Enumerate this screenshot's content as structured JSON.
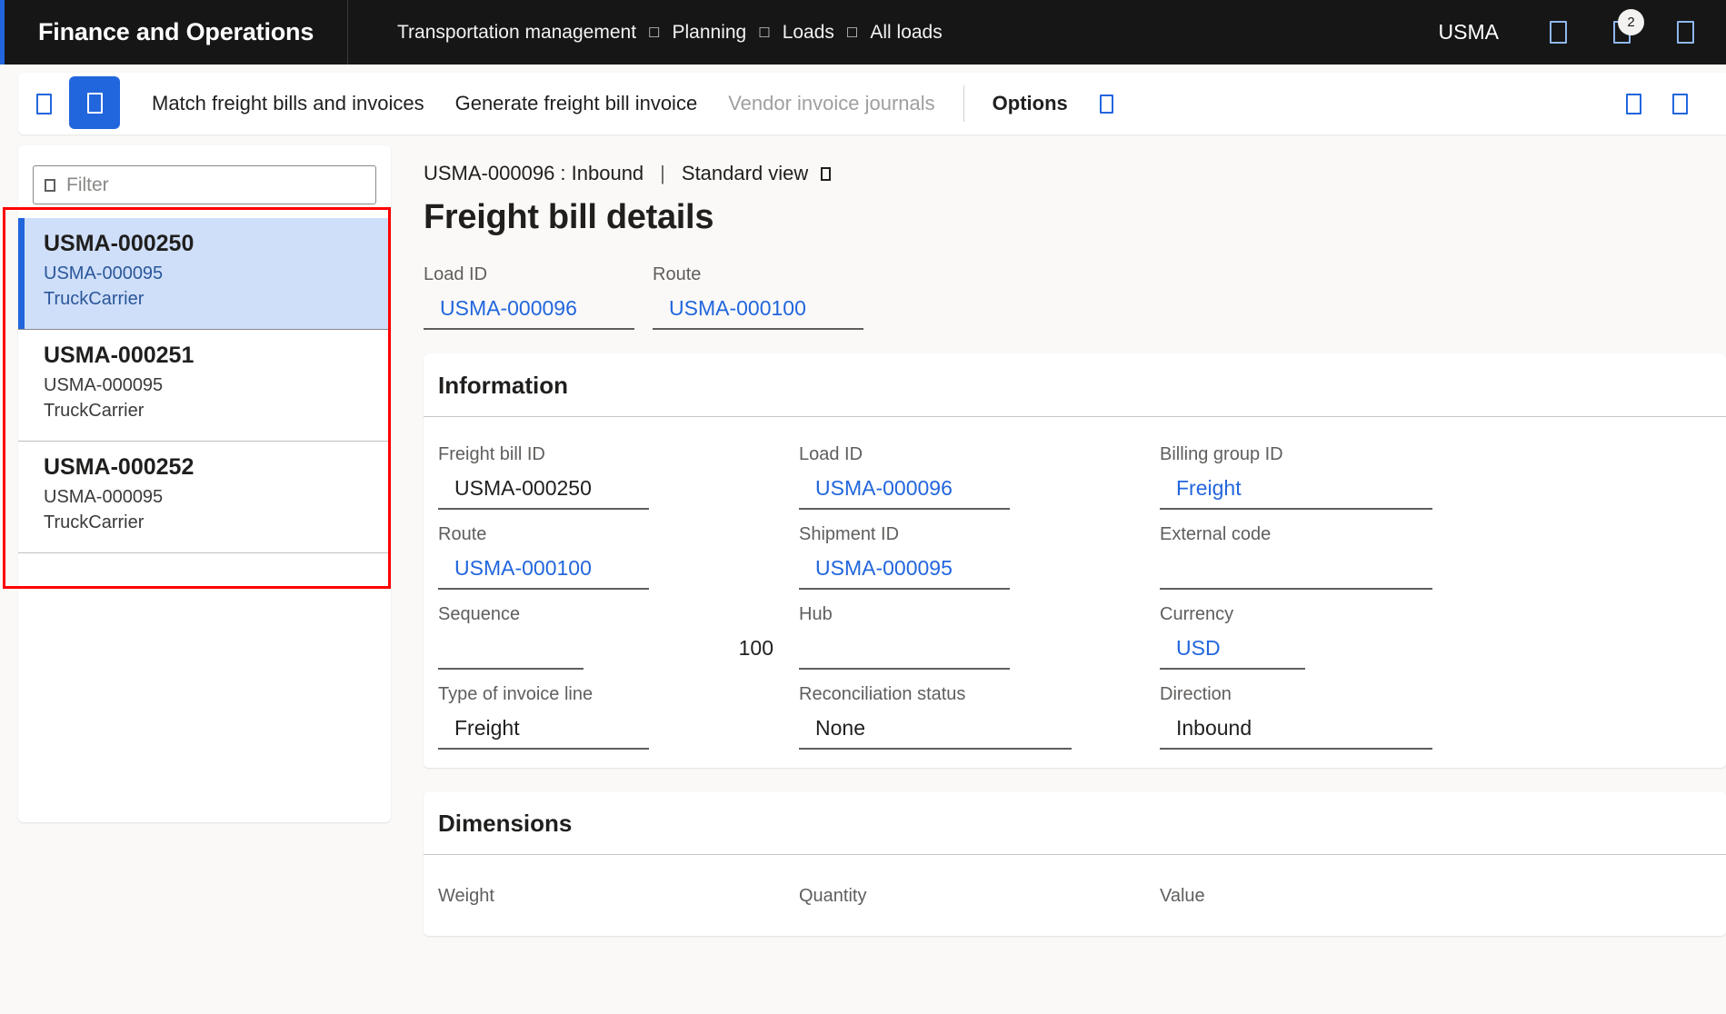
{
  "topnav": {
    "brand": "Finance and Operations",
    "breadcrumbs": [
      "Transportation management",
      "Planning",
      "Loads",
      "All loads"
    ],
    "separator_icon": "chevron-right-icon",
    "company": "USMA",
    "settings_icon": "gear-icon",
    "notifications_icon": "bell-icon",
    "notification_count": "2",
    "help_icon": "help-icon",
    "accent_color": "#2266dd",
    "background_color": "#161616"
  },
  "actionpane": {
    "save_icon": "save-icon",
    "menu_icon": "hamburger-icon",
    "buttons": [
      {
        "label": "Match freight bills and invoices",
        "state": "enabled"
      },
      {
        "label": "Generate freight bill invoice",
        "state": "enabled"
      },
      {
        "label": "Vendor invoice journals",
        "state": "disabled"
      },
      {
        "label": "Options",
        "state": "strong"
      }
    ],
    "options_chevron_icon": "chevron-down-icon",
    "share_icon": "share-icon",
    "attach_icon": "attachment-icon"
  },
  "listpanel": {
    "filter": {
      "icon": "filter-icon",
      "placeholder": "Filter",
      "value": ""
    },
    "items": [
      {
        "title": "USMA-000250",
        "sub1": "USMA-000095",
        "sub2": "TruckCarrier",
        "selected": true
      },
      {
        "title": "USMA-000251",
        "sub1": "USMA-000095",
        "sub2": "TruckCarrier",
        "selected": false
      },
      {
        "title": "USMA-000252",
        "sub1": "USMA-000095",
        "sub2": "TruckCarrier",
        "selected": false
      }
    ]
  },
  "annotation": {
    "color": "#ff0000"
  },
  "detail": {
    "breadcrumb_record": "USMA-000096 : Inbound",
    "breadcrumb_separator": "|",
    "breadcrumb_view": "Standard view",
    "view_chevron_icon": "chevron-down-icon",
    "title": "Freight bill details",
    "top_fields": [
      {
        "label": "Load ID",
        "value": "USMA-000096",
        "style": "link"
      },
      {
        "label": "Route",
        "value": "USMA-000100",
        "style": "link"
      }
    ],
    "information": {
      "header": "Information",
      "rows": [
        [
          {
            "label": "Freight bill ID",
            "value": "USMA-000250",
            "style": "text"
          },
          {
            "label": "Load ID",
            "value": "USMA-000096",
            "style": "link"
          },
          {
            "label": "Billing group ID",
            "value": "Freight",
            "style": "link"
          }
        ],
        [
          {
            "label": "Route",
            "value": "USMA-000100",
            "style": "link"
          },
          {
            "label": "Shipment ID",
            "value": "USMA-000095",
            "style": "link"
          },
          {
            "label": "External code",
            "value": "",
            "style": "text"
          }
        ],
        [
          {
            "label": "Sequence",
            "value": "100",
            "style": "number"
          },
          {
            "label": "Hub",
            "value": "",
            "style": "text"
          },
          {
            "label": "Currency",
            "value": "USD",
            "style": "link"
          }
        ],
        [
          {
            "label": "Type of invoice line",
            "value": "Freight",
            "style": "text"
          },
          {
            "label": "Reconciliation status",
            "value": "None",
            "style": "text"
          },
          {
            "label": "Direction",
            "value": "Inbound",
            "style": "text"
          }
        ]
      ]
    },
    "dimensions": {
      "header": "Dimensions",
      "labels": [
        "Weight",
        "Quantity",
        "Value"
      ]
    }
  }
}
